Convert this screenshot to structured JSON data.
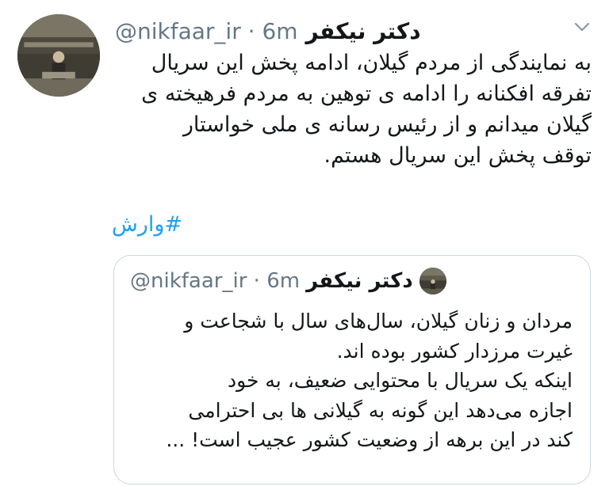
{
  "tweet": {
    "display_name": "دکتر نیکفر",
    "handle": "@nikfaar_ir",
    "separator": "·",
    "time": "6m",
    "body_lines": [
      "به نمایندگی از مردم گیلان، ادامه پخش این سریال",
      "تفرقه افکنانه را ادامه ی توهین به مردم فرهیخته ی",
      "گیلان میدانم و از رئیس رسانه ی ملی خواستار",
      "توقف پخش این سریال هستم."
    ],
    "hashtag": "#وارش",
    "menu_icon": "chevron-down-icon",
    "colors": {
      "text": "#14171a",
      "meta": "#657786",
      "link": "#1da1f2",
      "border": "#ccd6dd"
    }
  },
  "quoted_tweet": {
    "display_name": "دکتر نیکفر",
    "handle": "@nikfaar_ir",
    "separator": "·",
    "time": "6m",
    "body_lines": [
      "مردان و زنان گیلان، سال‌های سال با شجاعت و",
      "غیرت مرزدار کشور بوده اند.",
      "اینکه یک سریال با محتوایی ضعیف، به خود",
      "اجازه می‌دهد این گونه به گیلانی ها بی احترامی",
      "کند در این برهه از وضعیت کشور عجیب است! ..."
    ]
  }
}
